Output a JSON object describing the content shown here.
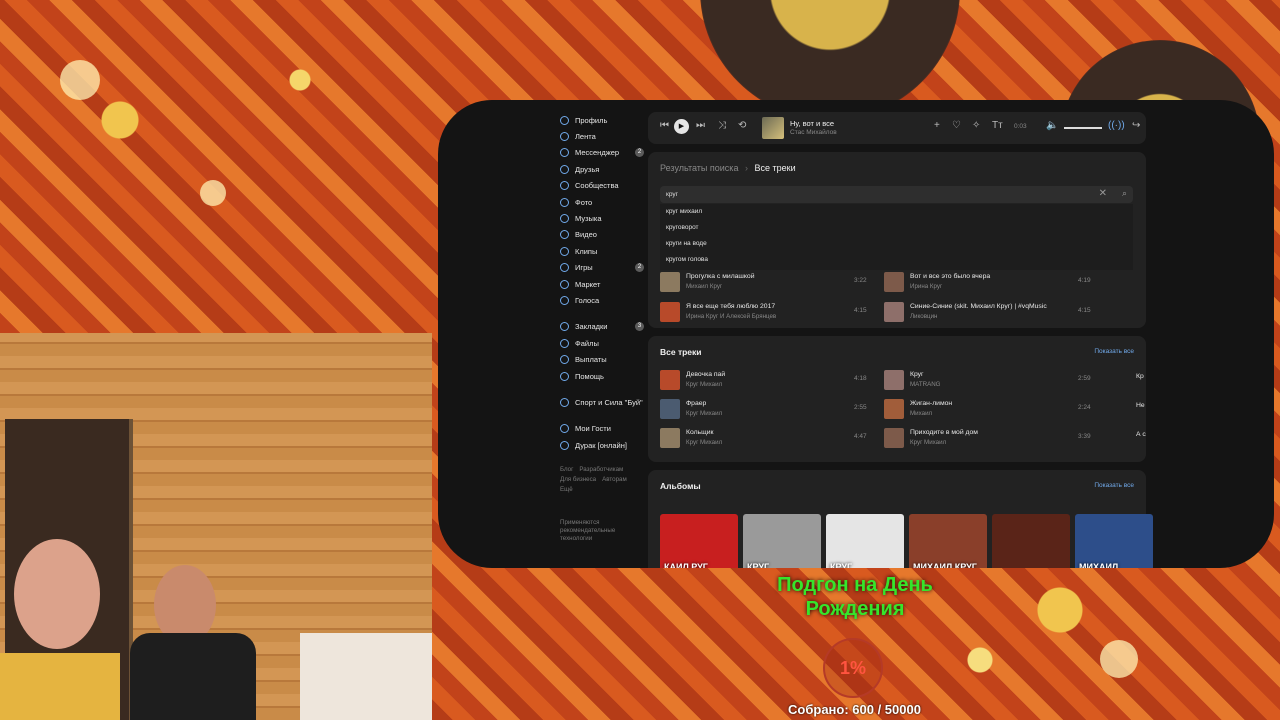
{
  "sidebar": {
    "items": [
      {
        "label": "Профиль",
        "badge": ""
      },
      {
        "label": "Лента",
        "badge": ""
      },
      {
        "label": "Мессенджер",
        "badge": "2"
      },
      {
        "label": "Друзья",
        "badge": ""
      },
      {
        "label": "Сообщества",
        "badge": ""
      },
      {
        "label": "Фото",
        "badge": ""
      },
      {
        "label": "Музыка",
        "badge": ""
      },
      {
        "label": "Видео",
        "badge": ""
      },
      {
        "label": "Клипы",
        "badge": ""
      },
      {
        "label": "Игры",
        "badge": "2"
      },
      {
        "label": "Маркет",
        "badge": ""
      },
      {
        "label": "Голоса",
        "badge": ""
      }
    ],
    "items2": [
      {
        "label": "Закладки",
        "badge": "3"
      },
      {
        "label": "Файлы",
        "badge": ""
      },
      {
        "label": "Выплаты",
        "badge": ""
      },
      {
        "label": "Помощь",
        "badge": ""
      }
    ],
    "community": "Спорт и Сила \"Буй\"",
    "games": [
      "Мои Гости",
      "Дурак [онлайн]"
    ],
    "footer": [
      "Блог",
      "Разработчикам",
      "Для бизнеса",
      "Авторам",
      "Ещё"
    ],
    "tech": "Применяются рекомендательные технологии"
  },
  "player": {
    "title": "Ну, вот и все",
    "artist": "Стас Михайлов",
    "time": "0:03",
    "volume": 0.8
  },
  "search": {
    "crumb_parent": "Результаты поиска",
    "crumb_current": "Все треки",
    "value": "круг",
    "suggestions": [
      "круг михаил",
      "круговорот",
      "круги на воде",
      "кругом голова"
    ]
  },
  "top_tracks": [
    {
      "title": "Прогулка с милашкой",
      "artist": "Михаил Круг",
      "dur": "3:22"
    },
    {
      "title": "Вот и все это было вчера",
      "artist": "Ирина Круг",
      "dur": "4:19"
    },
    {
      "title": "Я все еще тебя люблю 2017",
      "artist": "Ирина Круг И Алексей Брянцев",
      "dur": "4:15"
    },
    {
      "title": "Синие-Синие (skit. Михаил Круг) | #vqMusic",
      "artist": "Ликовцин",
      "dur": "4:15"
    }
  ],
  "all_tracks": {
    "title": "Все треки",
    "show_all": "Показать все",
    "items": [
      {
        "title": "Девочка пай",
        "artist": "Круг Михаил",
        "dur": "4:18"
      },
      {
        "title": "Круг",
        "artist": "MATRANG",
        "dur": "2:59"
      },
      {
        "title": "Фраер",
        "artist": "Круг Михаил",
        "dur": "2:55"
      },
      {
        "title": "Жиган-лимон",
        "artist": "Михаил",
        "dur": "2:24"
      },
      {
        "title": "Кольщик",
        "artist": "Круг Михаил",
        "dur": "4:47"
      },
      {
        "title": "Приходите в мой дом",
        "artist": "Круг Михаил",
        "dur": "3:39"
      }
    ],
    "edge_labels": [
      "Кр",
      "Не",
      "А с"
    ]
  },
  "albums": {
    "title": "Альбомы",
    "show_all": "Показать все",
    "covers": [
      "КАИЛ РУГ",
      "КРУГ",
      "КРУГ",
      "МИХАИЛ КРУГ",
      "",
      "МИХАИЛ"
    ],
    "cover_colors": [
      "#c81f1f",
      "#9a9a9a",
      "#e5e5e5",
      "#8a3f2a",
      "#5a2418",
      "#2d4e8a"
    ]
  },
  "overlay": {
    "goal": "Подгон на День Рождения",
    "percent": "1%",
    "collected": "Собрано: 600 / 50000"
  }
}
